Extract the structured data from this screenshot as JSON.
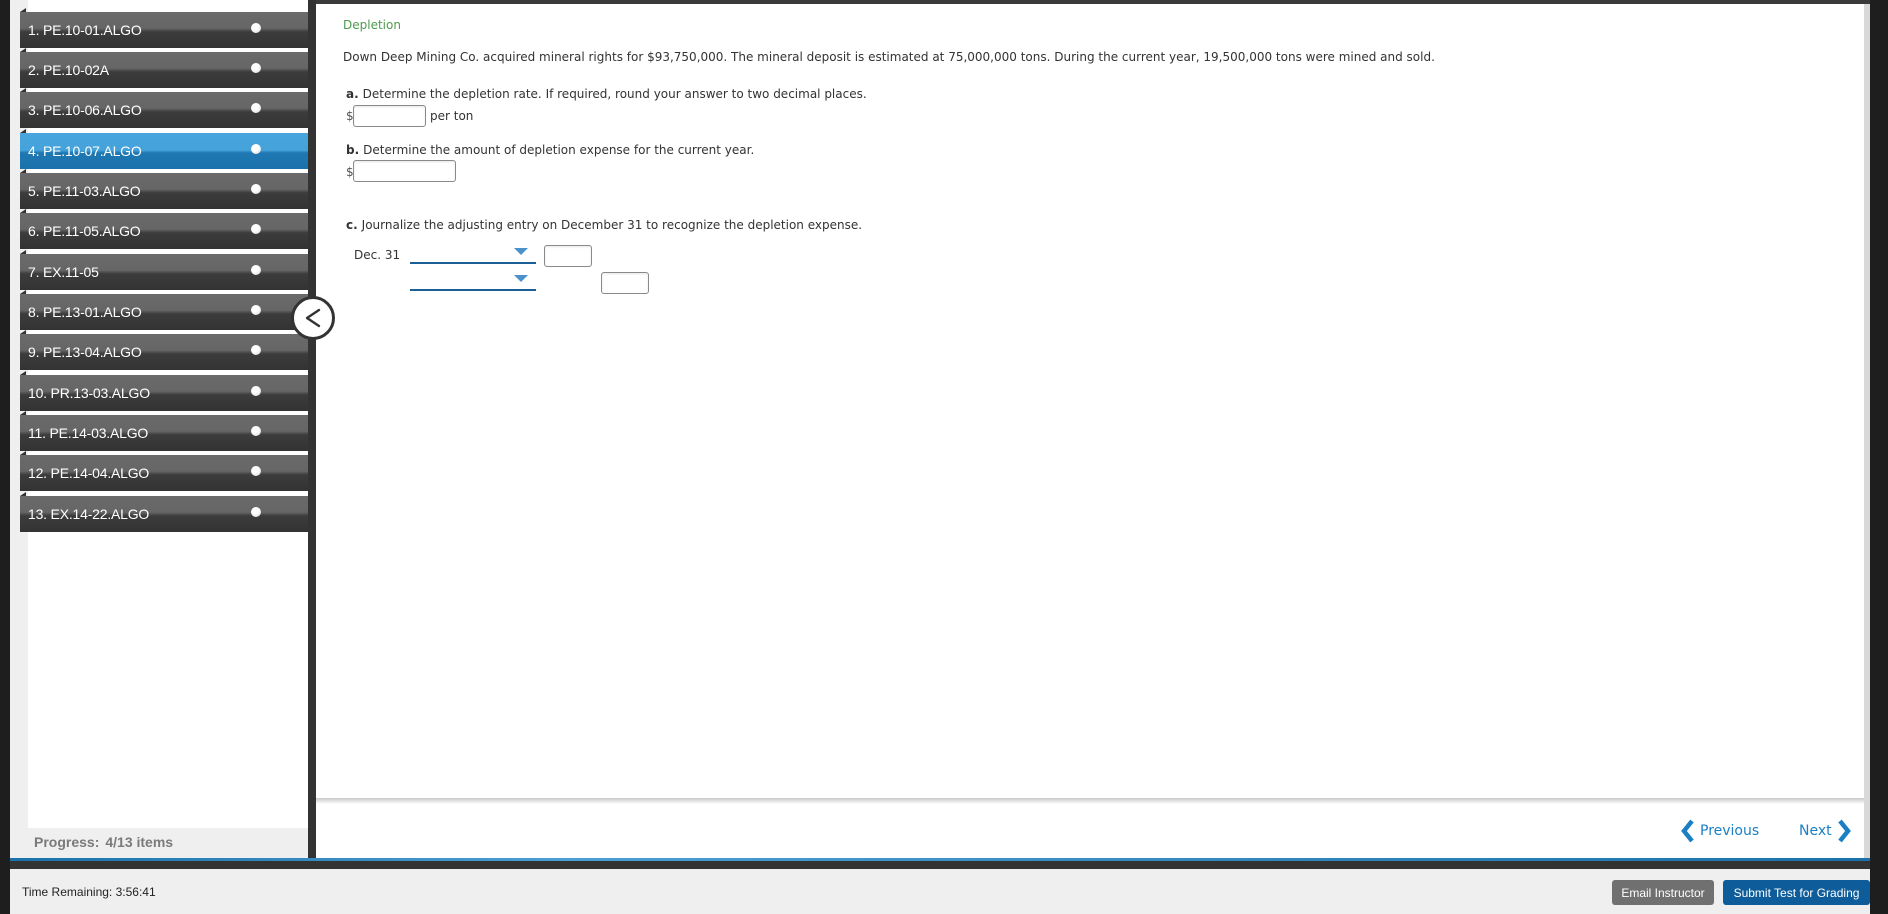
{
  "sidebar": {
    "items": [
      {
        "label": "1. PE.10-01.ALGO",
        "active": false
      },
      {
        "label": "2. PE.10-02A",
        "active": false
      },
      {
        "label": "3. PE.10-06.ALGO",
        "active": false
      },
      {
        "label": "4. PE.10-07.ALGO",
        "active": true
      },
      {
        "label": "5. PE.11-03.ALGO",
        "active": false
      },
      {
        "label": "6. PE.11-05.ALGO",
        "active": false
      },
      {
        "label": "7. EX.11-05",
        "active": false
      },
      {
        "label": "8. PE.13-01.ALGO",
        "active": false
      },
      {
        "label": "9. PE.13-04.ALGO",
        "active": false
      },
      {
        "label": "10. PR.13-03.ALGO",
        "active": false
      },
      {
        "label": "11. PE.14-03.ALGO",
        "active": false
      },
      {
        "label": "12. PE.14-04.ALGO",
        "active": false
      },
      {
        "label": "13. EX.14-22.ALGO",
        "active": false
      }
    ],
    "progress_label": "Progress:",
    "progress_value": "4/13 items",
    "collapse_icon": "chevron-left-icon"
  },
  "question": {
    "title": "Depletion",
    "text": "Down Deep Mining Co. acquired mineral rights for $93,750,000. The mineral deposit is estimated at 75,000,000 tons. During the current year, 19,500,000 tons were mined and sold.",
    "part_a": {
      "letter": "a.",
      "prompt": "Determine the depletion rate. If required, round your answer to two decimal places.",
      "currency": "$",
      "value": "",
      "unit": "per ton"
    },
    "part_b": {
      "letter": "b.",
      "prompt": "Determine the amount of depletion expense for the current year.",
      "currency": "$",
      "value": ""
    },
    "part_c": {
      "letter": "c.",
      "prompt": "Journalize the adjusting entry on December 31 to recognize the depletion expense.",
      "date": "Dec. 31",
      "rows": [
        {
          "account": "",
          "debit": "",
          "credit": null
        },
        {
          "account": "",
          "debit": null,
          "credit": ""
        }
      ]
    }
  },
  "navigation": {
    "previous_label": "Previous",
    "next_label": "Next"
  },
  "footer": {
    "time_remaining": "Time Remaining: 3:56:41",
    "email_label": "Email Instructor",
    "submit_label": "Submit Test for Grading"
  },
  "colors": {
    "accent_blue": "#1b72ab",
    "active_item": "#45a2da",
    "title_green": "#4d9a4d",
    "link_blue": "#1a7fc4",
    "submit_button": "#0e5d9a",
    "email_button": "#707070"
  }
}
